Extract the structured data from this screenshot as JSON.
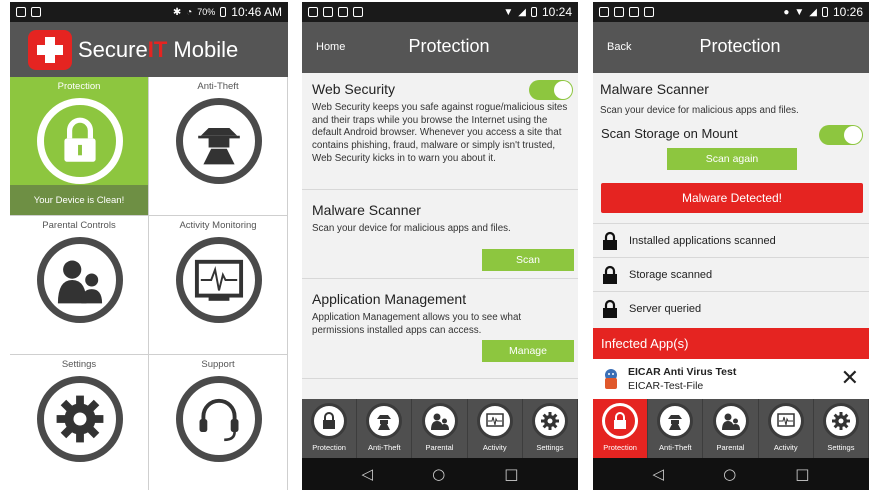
{
  "screen1": {
    "status": {
      "battery": "70%",
      "time": "10:46 AM"
    },
    "brand": {
      "pre": "Secure",
      "it": "IT",
      "post": " Mobile"
    },
    "tiles": [
      {
        "label": "Protection",
        "icon": "lock-icon"
      },
      {
        "label": "Anti-Theft",
        "icon": "spy-icon"
      },
      {
        "label": "Parental Controls",
        "icon": "family-icon"
      },
      {
        "label": "Activity Monitoring",
        "icon": "monitor-icon"
      },
      {
        "label": "Settings",
        "icon": "gear-icon"
      },
      {
        "label": "Support",
        "icon": "headset-icon"
      }
    ],
    "clean_status": "Your Device is Clean!"
  },
  "screen2": {
    "status": {
      "time": "10:24"
    },
    "nav_label": "Home",
    "title": "Protection",
    "sections": [
      {
        "title": "Web Security",
        "text": "Web Security keeps you safe against rogue/malicious sites and their traps while you browse the Internet using the default Android browser.  Whenever you access a site that contains phishing, fraud, malware or simply isn't trusted, Web Security kicks in to warn you about it."
      },
      {
        "title": "Malware Scanner",
        "text": "Scan your device for malicious apps and files.",
        "button": "Scan"
      },
      {
        "title": "Application Management",
        "text": "Application Management allows you to see what permissions installed apps can access.",
        "button": "Manage"
      }
    ]
  },
  "screen3": {
    "status": {
      "time": "10:26"
    },
    "nav_label": "Back",
    "title": "Protection",
    "scanner_title": "Malware Scanner",
    "scanner_text": "Scan your device for malicious apps and files.",
    "scan_mount_label": "Scan Storage on Mount",
    "scan_again": "Scan again",
    "alert": "Malware Detected!",
    "checks": [
      "Installed applications scanned",
      "Storage scanned",
      "Server queried"
    ],
    "infected_header": "Infected App(s)",
    "infected_app": {
      "name": "EICAR Anti Virus Test",
      "file": "EICAR-Test-File"
    }
  },
  "tabs": [
    "Protection",
    "Anti-Theft",
    "Parental",
    "Activity",
    "Settings"
  ],
  "colors": {
    "accent_green": "#8dc63f",
    "alert_red": "#e52421",
    "header_gray": "#555555"
  }
}
